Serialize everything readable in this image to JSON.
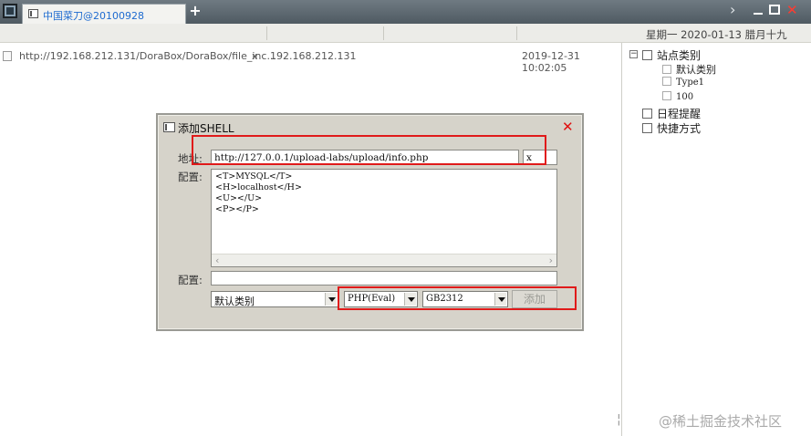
{
  "tabbar": {
    "tab_label": "中国菜刀@20100928",
    "new_tab_label": "+",
    "next_glyph": "›",
    "close_glyph": "✕"
  },
  "status": {
    "date_text": "星期一 2020-01-13 腊月十九"
  },
  "list": {
    "rows": [
      {
        "url": "http://192.168.212.131/DoraBox/DoraBox/file_inc...",
        "x": "x",
        "ip": "192.168.212.131",
        "time": "2019-12-31 10:02:05"
      }
    ]
  },
  "tree": {
    "collapse_glyph": "−",
    "root": "站点类别",
    "children": [
      "默认类别",
      "Type1",
      "100"
    ],
    "schedule": "日程提醒",
    "shortcuts": "快捷方式"
  },
  "dialog": {
    "title": "添加SHELL",
    "close_glyph": "✕",
    "address_label": "地址:",
    "address_value": "http://127.0.0.1/upload-labs/upload/info.php",
    "password_value": "x",
    "config_label": "配置:",
    "config_lines": [
      "<T>MYSQL</T>",
      "<H>localhost</H>",
      "<U></U>",
      "<P></P>"
    ],
    "scroll_left": "‹",
    "scroll_right": "›",
    "config2_label": "配置:",
    "config2_value": "",
    "category_value": "默认类别",
    "script_type_value": "PHP(Eval)",
    "encoding_value": "GB2312",
    "add_button": "添加"
  },
  "watermark": "@稀土掘金技术社区",
  "colors": {
    "highlight": "#e01a1a",
    "tab_text": "#1e6bd0",
    "close_red": "#e01010"
  }
}
